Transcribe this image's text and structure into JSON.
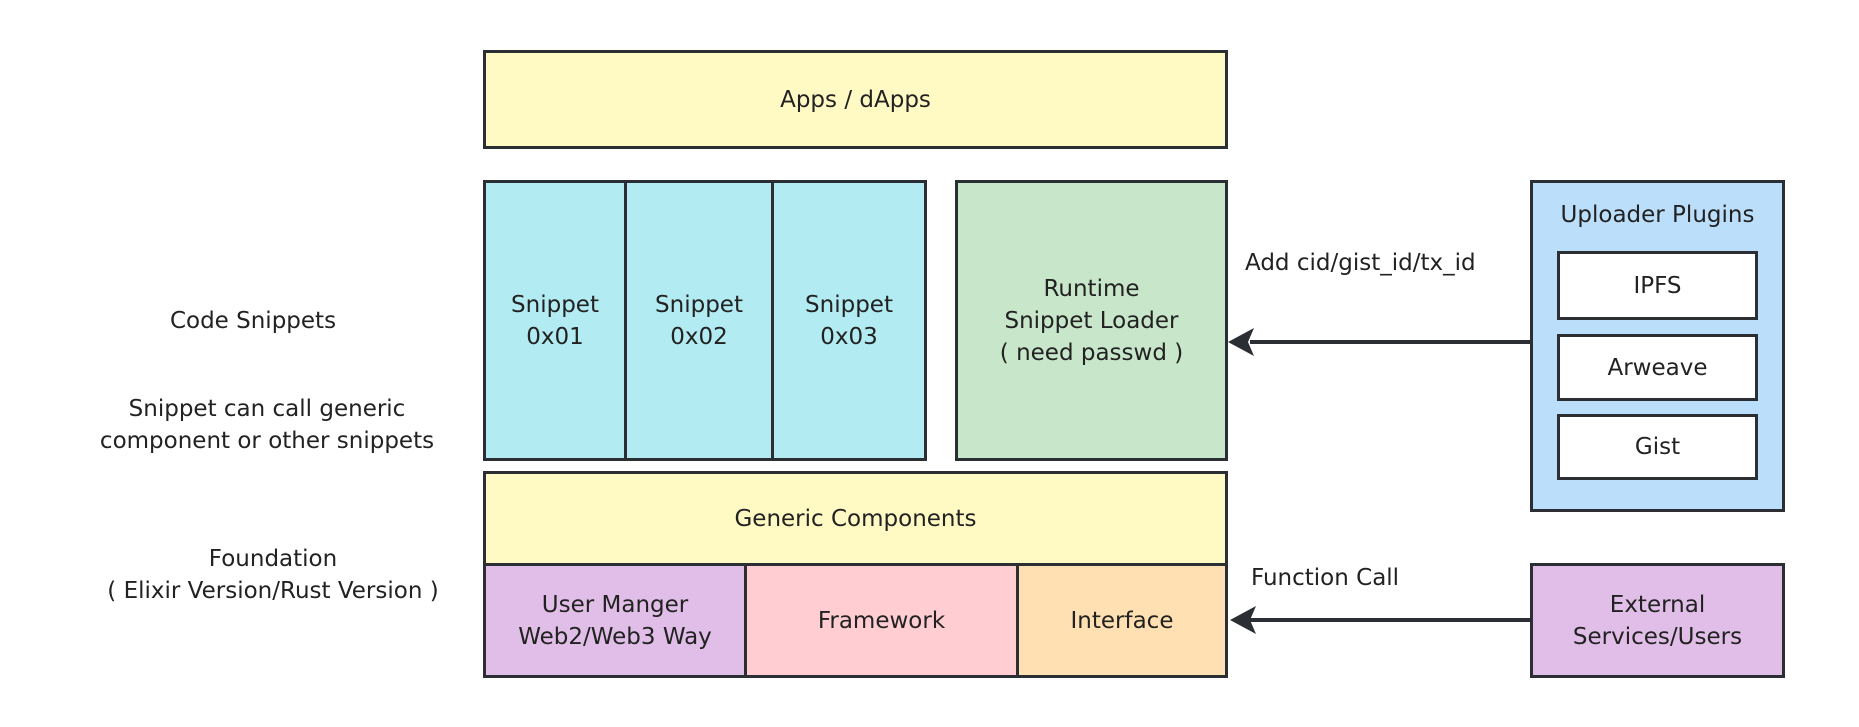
{
  "labels": {
    "code_snippets": "Code Snippets",
    "snippet_note": "Snippet can call generic\ncomponent or other snippets",
    "foundation": "Foundation\n( Elixir Version/Rust Version )"
  },
  "boxes": {
    "apps": "Apps / dApps",
    "snippets": [
      "Snippet\n0x01",
      "Snippet\n0x02",
      "Snippet\n0x03"
    ],
    "runtime_loader": "Runtime\nSnippet Loader\n( need passwd )",
    "uploader_title": "Uploader Plugins",
    "uploader_items": [
      "IPFS",
      "Arweave",
      "Gist"
    ],
    "generic_components": "Generic Components",
    "user_manager": "User Manger\nWeb2/Web3 Way",
    "framework": "Framework",
    "interface": "Interface",
    "external": "External\nServices/Users"
  },
  "edges": {
    "upload_label": "Add cid/gist_id/tx_id",
    "function_call_label": "Function Call"
  },
  "colors": {
    "yellow": "#fff9c4",
    "cyan": "#b2ebf2",
    "green": "#c8e6c9",
    "blue": "#bbdefb",
    "purple": "#e1bee7",
    "pink": "#ffcdd2",
    "orange": "#ffe0b2",
    "stroke": "#2b2f33"
  }
}
